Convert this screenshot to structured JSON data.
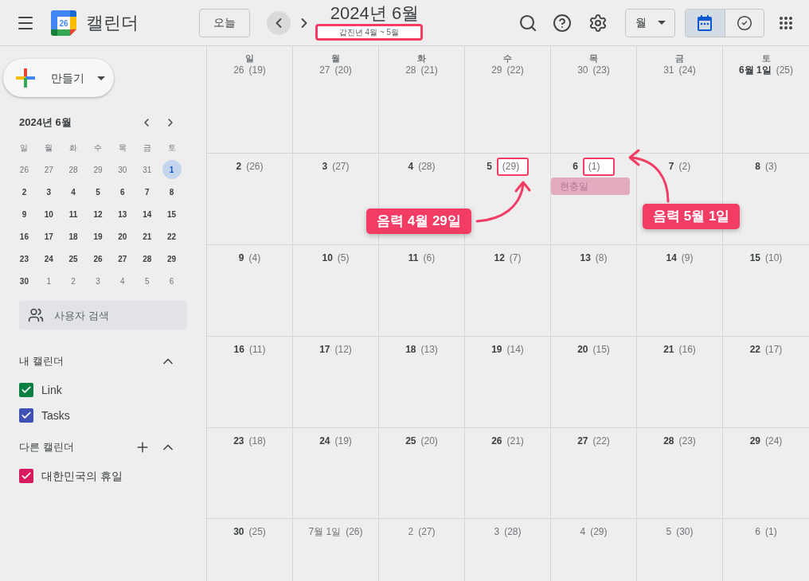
{
  "header": {
    "app_name": "캘린더",
    "logo_number": "26",
    "today_button": "오늘",
    "nav_buttons": [
      {
        "kind": "previous",
        "hovered": true
      },
      {
        "kind": "next",
        "hovered": false
      }
    ],
    "title": "2024년 6월",
    "subtitle": {
      "text": "갑진년 4월 ~ 5월",
      "highlighted": true
    },
    "view_select": "월",
    "view_toggle": [
      {
        "kind": "calendar",
        "selected": true
      },
      {
        "kind": "tasks",
        "selected": false
      }
    ]
  },
  "sidebar": {
    "create_button": "만들기",
    "mini_calendar": {
      "title": "2024년 6월",
      "weekdays": [
        "일",
        "월",
        "화",
        "수",
        "목",
        "금",
        "토"
      ],
      "weeks": [
        [
          {
            "day": "26",
            "in_month": false,
            "selected": false
          },
          {
            "day": "27",
            "in_month": false,
            "selected": false
          },
          {
            "day": "28",
            "in_month": false,
            "selected": false
          },
          {
            "day": "29",
            "in_month": false,
            "selected": false
          },
          {
            "day": "30",
            "in_month": false,
            "selected": false
          },
          {
            "day": "31",
            "in_month": false,
            "selected": false
          },
          {
            "day": "1",
            "in_month": true,
            "selected": true
          }
        ],
        [
          {
            "day": "2",
            "in_month": true,
            "selected": false
          },
          {
            "day": "3",
            "in_month": true,
            "selected": false
          },
          {
            "day": "4",
            "in_month": true,
            "selected": false
          },
          {
            "day": "5",
            "in_month": true,
            "selected": false
          },
          {
            "day": "6",
            "in_month": true,
            "selected": false
          },
          {
            "day": "7",
            "in_month": true,
            "selected": false
          },
          {
            "day": "8",
            "in_month": true,
            "selected": false
          }
        ],
        [
          {
            "day": "9",
            "in_month": true,
            "selected": false
          },
          {
            "day": "10",
            "in_month": true,
            "selected": false
          },
          {
            "day": "11",
            "in_month": true,
            "selected": false
          },
          {
            "day": "12",
            "in_month": true,
            "selected": false
          },
          {
            "day": "13",
            "in_month": true,
            "selected": false
          },
          {
            "day": "14",
            "in_month": true,
            "selected": false
          },
          {
            "day": "15",
            "in_month": true,
            "selected": false
          }
        ],
        [
          {
            "day": "16",
            "in_month": true,
            "selected": false
          },
          {
            "day": "17",
            "in_month": true,
            "selected": false
          },
          {
            "day": "18",
            "in_month": true,
            "selected": false
          },
          {
            "day": "19",
            "in_month": true,
            "selected": false
          },
          {
            "day": "20",
            "in_month": true,
            "selected": false
          },
          {
            "day": "21",
            "in_month": true,
            "selected": false
          },
          {
            "day": "22",
            "in_month": true,
            "selected": false
          }
        ],
        [
          {
            "day": "23",
            "in_month": true,
            "selected": false
          },
          {
            "day": "24",
            "in_month": true,
            "selected": false
          },
          {
            "day": "25",
            "in_month": true,
            "selected": false
          },
          {
            "day": "26",
            "in_month": true,
            "selected": false
          },
          {
            "day": "27",
            "in_month": true,
            "selected": false
          },
          {
            "day": "28",
            "in_month": true,
            "selected": false
          },
          {
            "day": "29",
            "in_month": true,
            "selected": false
          }
        ],
        [
          {
            "day": "30",
            "in_month": true,
            "selected": false
          },
          {
            "day": "1",
            "in_month": false,
            "selected": false
          },
          {
            "day": "2",
            "in_month": false,
            "selected": false
          },
          {
            "day": "3",
            "in_month": false,
            "selected": false
          },
          {
            "day": "4",
            "in_month": false,
            "selected": false
          },
          {
            "day": "5",
            "in_month": false,
            "selected": false
          },
          {
            "day": "6",
            "in_month": false,
            "selected": false
          }
        ]
      ]
    },
    "people_search": {
      "placeholder": "사용자 검색"
    },
    "calendar_groups": [
      {
        "title": "내 캘린더",
        "expanded": true,
        "can_add": false,
        "items": [
          {
            "label": "Link",
            "checked": true,
            "color": "#0b8043"
          },
          {
            "label": "Tasks",
            "checked": true,
            "color": "#3f51b5"
          }
        ]
      },
      {
        "title": "다른 캘린더",
        "expanded": true,
        "can_add": true,
        "items": [
          {
            "label": "대한민국의 휴일",
            "checked": true,
            "color": "#d81b60"
          }
        ]
      }
    ]
  },
  "calendar": {
    "weekdays": [
      "일",
      "월",
      "화",
      "수",
      "목",
      "금",
      "토"
    ],
    "weeks": [
      [
        {
          "date": "26",
          "lunar": "(19)",
          "in_month": false,
          "highlighted": false
        },
        {
          "date": "27",
          "lunar": "(20)",
          "in_month": false,
          "highlighted": false
        },
        {
          "date": "28",
          "lunar": "(21)",
          "in_month": false,
          "highlighted": false
        },
        {
          "date": "29",
          "lunar": "(22)",
          "in_month": false,
          "highlighted": false
        },
        {
          "date": "30",
          "lunar": "(23)",
          "in_month": false,
          "highlighted": false
        },
        {
          "date": "31",
          "lunar": "(24)",
          "in_month": false,
          "highlighted": false
        },
        {
          "date": "6월 1일",
          "lunar": "(25)",
          "in_month": true,
          "highlighted": false
        }
      ],
      [
        {
          "date": "2",
          "lunar": "(26)",
          "in_month": true,
          "highlighted": false
        },
        {
          "date": "3",
          "lunar": "(27)",
          "in_month": true,
          "highlighted": false
        },
        {
          "date": "4",
          "lunar": "(28)",
          "in_month": true,
          "highlighted": false
        },
        {
          "date": "5",
          "lunar": "(29)",
          "in_month": true,
          "highlighted": true
        },
        {
          "date": "6",
          "lunar": "(1)",
          "in_month": true,
          "highlighted": true,
          "events": [
            {
              "title": "현충일",
              "color": "#e2abbf"
            }
          ]
        },
        {
          "date": "7",
          "lunar": "(2)",
          "in_month": true,
          "highlighted": false
        },
        {
          "date": "8",
          "lunar": "(3)",
          "in_month": true,
          "highlighted": false
        }
      ],
      [
        {
          "date": "9",
          "lunar": "(4)",
          "in_month": true,
          "highlighted": false
        },
        {
          "date": "10",
          "lunar": "(5)",
          "in_month": true,
          "highlighted": false
        },
        {
          "date": "11",
          "lunar": "(6)",
          "in_month": true,
          "highlighted": false
        },
        {
          "date": "12",
          "lunar": "(7)",
          "in_month": true,
          "highlighted": false
        },
        {
          "date": "13",
          "lunar": "(8)",
          "in_month": true,
          "highlighted": false
        },
        {
          "date": "14",
          "lunar": "(9)",
          "in_month": true,
          "highlighted": false
        },
        {
          "date": "15",
          "lunar": "(10)",
          "in_month": true,
          "highlighted": false
        }
      ],
      [
        {
          "date": "16",
          "lunar": "(11)",
          "in_month": true,
          "highlighted": false
        },
        {
          "date": "17",
          "lunar": "(12)",
          "in_month": true,
          "highlighted": false
        },
        {
          "date": "18",
          "lunar": "(13)",
          "in_month": true,
          "highlighted": false
        },
        {
          "date": "19",
          "lunar": "(14)",
          "in_month": true,
          "highlighted": false
        },
        {
          "date": "20",
          "lunar": "(15)",
          "in_month": true,
          "highlighted": false
        },
        {
          "date": "21",
          "lunar": "(16)",
          "in_month": true,
          "highlighted": false
        },
        {
          "date": "22",
          "lunar": "(17)",
          "in_month": true,
          "highlighted": false
        }
      ],
      [
        {
          "date": "23",
          "lunar": "(18)",
          "in_month": true,
          "highlighted": false
        },
        {
          "date": "24",
          "lunar": "(19)",
          "in_month": true,
          "highlighted": false
        },
        {
          "date": "25",
          "lunar": "(20)",
          "in_month": true,
          "highlighted": false
        },
        {
          "date": "26",
          "lunar": "(21)",
          "in_month": true,
          "highlighted": false
        },
        {
          "date": "27",
          "lunar": "(22)",
          "in_month": true,
          "highlighted": false
        },
        {
          "date": "28",
          "lunar": "(23)",
          "in_month": true,
          "highlighted": false
        },
        {
          "date": "29",
          "lunar": "(24)",
          "in_month": true,
          "highlighted": false
        }
      ],
      [
        {
          "date": "30",
          "lunar": "(25)",
          "in_month": true,
          "highlighted": false
        },
        {
          "date": "7월 1일",
          "lunar": "(26)",
          "in_month": false,
          "highlighted": false
        },
        {
          "date": "2",
          "lunar": "(27)",
          "in_month": false,
          "highlighted": false
        },
        {
          "date": "3",
          "lunar": "(28)",
          "in_month": false,
          "highlighted": false
        },
        {
          "date": "4",
          "lunar": "(29)",
          "in_month": false,
          "highlighted": false
        },
        {
          "date": "5",
          "lunar": "(30)",
          "in_month": false,
          "highlighted": false
        },
        {
          "date": "6",
          "lunar": "(1)",
          "in_month": false,
          "highlighted": false
        }
      ]
    ]
  },
  "callouts": [
    {
      "text": "음력 4월 29일"
    },
    {
      "text": "음력 5월 1일"
    }
  ]
}
